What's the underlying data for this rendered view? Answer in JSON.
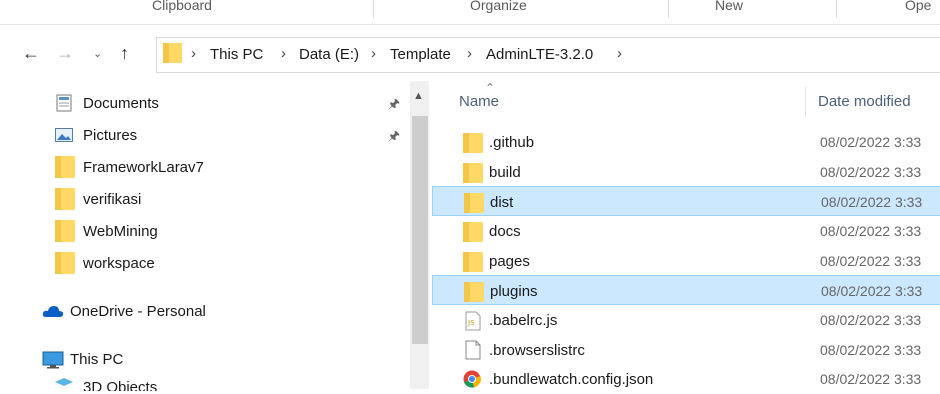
{
  "ribbon": {
    "groups": [
      "Clipboard",
      "Organize",
      "New",
      "Ope"
    ]
  },
  "address": {
    "crumbs": [
      "This PC",
      "Data (E:)",
      "Template",
      "AdminLTE-3.2.0"
    ]
  },
  "nav_pane": {
    "items": [
      {
        "label": "Documents",
        "icon": "documents-icon",
        "pinned": true
      },
      {
        "label": "Pictures",
        "icon": "pictures-icon",
        "pinned": true
      },
      {
        "label": "FrameworkLarav7",
        "icon": "folder-icon",
        "pinned": false
      },
      {
        "label": "verifikasi",
        "icon": "folder-icon",
        "pinned": false
      },
      {
        "label": "WebMining",
        "icon": "folder-icon",
        "pinned": false
      },
      {
        "label": "workspace",
        "icon": "folder-icon",
        "pinned": false
      },
      {
        "label": "OneDrive - Personal",
        "icon": "onedrive-icon",
        "pinned": false
      },
      {
        "label": "This PC",
        "icon": "this-pc-icon",
        "pinned": false
      },
      {
        "label": "3D Objects",
        "icon": "3d-objects-icon",
        "pinned": false
      }
    ]
  },
  "file_list": {
    "columns": {
      "name": "Name",
      "date": "Date modified"
    },
    "rows": [
      {
        "name": ".github",
        "date": "08/02/2022 3:33",
        "icon": "folder-icon",
        "selected": false
      },
      {
        "name": "build",
        "date": "08/02/2022 3:33",
        "icon": "folder-icon",
        "selected": false
      },
      {
        "name": "dist",
        "date": "08/02/2022 3:33",
        "icon": "folder-icon",
        "selected": true
      },
      {
        "name": "docs",
        "date": "08/02/2022 3:33",
        "icon": "folder-icon",
        "selected": false
      },
      {
        "name": "pages",
        "date": "08/02/2022 3:33",
        "icon": "folder-icon",
        "selected": false
      },
      {
        "name": "plugins",
        "date": "08/02/2022 3:33",
        "icon": "folder-icon",
        "selected": true
      },
      {
        "name": ".babelrc.js",
        "date": "08/02/2022 3:33",
        "icon": "js-file-icon",
        "selected": false
      },
      {
        "name": ".browserslistrc",
        "date": "08/02/2022 3:33",
        "icon": "file-icon",
        "selected": false
      },
      {
        "name": ".bundlewatch.config.json",
        "date": "08/02/2022 3:33",
        "icon": "chrome-file-icon",
        "selected": false
      }
    ]
  },
  "colors": {
    "selection_bg": "#cce8ff",
    "selection_border": "#99d1ff",
    "folder_yellow": "#ffd866",
    "header_text": "#4c607a"
  }
}
